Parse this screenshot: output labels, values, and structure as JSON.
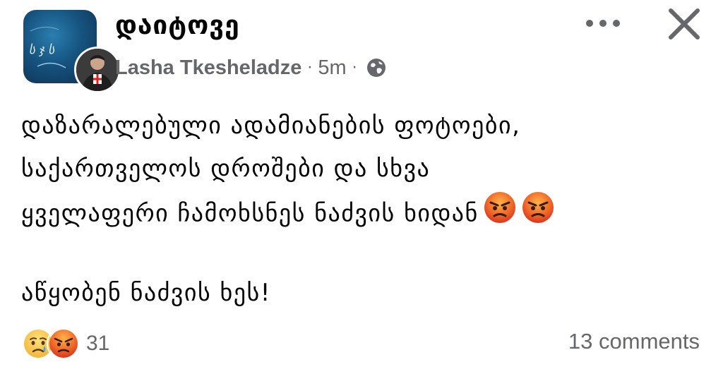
{
  "header": {
    "group_name": "დაიტოვე",
    "avatar_text": "ს ჯ ს",
    "author": "Lasha Tkesheladze",
    "separator": "·",
    "time": "5m",
    "icons": {
      "privacy": "globe-icon",
      "more": "more-options-icon",
      "close": "close-icon"
    }
  },
  "post": {
    "lines": [
      "დაზარალებული ადამიანების ფოტოები,",
      "საქართველოს დროშები და სხვა",
      "ყველაფერი ჩამოხსნეს ნაძვის ხიდან"
    ],
    "line_emoji": [
      "angry-face-emoji",
      "angry-face-emoji"
    ],
    "second_paragraph": "აწყობენ ნაძვის ხეს!"
  },
  "footer": {
    "reactions": [
      "sad-reaction-icon",
      "angry-reaction-icon"
    ],
    "reaction_count": "31",
    "comments": "13 comments"
  },
  "colors": {
    "text": "#050505",
    "meta": "#65676b",
    "angry": "#e8522a",
    "sad": "#f7c84a",
    "avatar_bg": "#16537f"
  }
}
